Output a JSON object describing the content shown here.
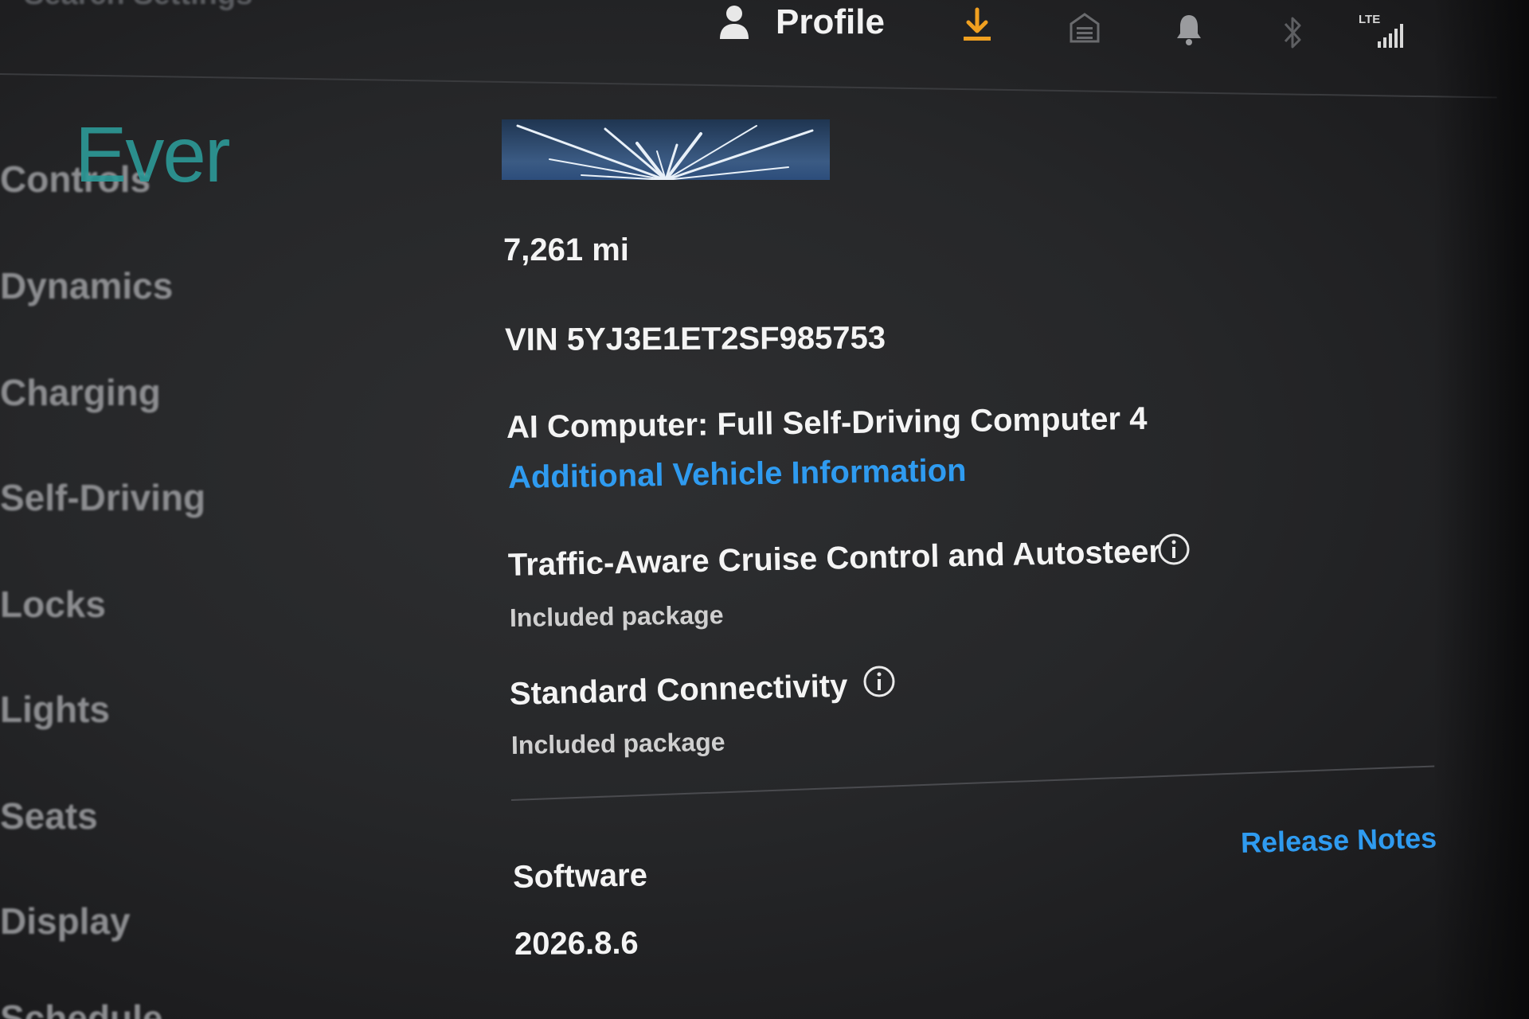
{
  "topbar": {
    "search_placeholder": "Search Settings",
    "profile_label": "Profile",
    "icons": [
      "person-icon",
      "download-icon",
      "garage-icon",
      "bell-icon",
      "bluetooth-icon",
      "lte-signal-icon"
    ],
    "lte_label": "LTE",
    "accent_color": "#f0a020"
  },
  "logo_overlay": {
    "text": "Ever",
    "color": "#2c9a98"
  },
  "sidebar": {
    "items": [
      {
        "label": "Controls"
      },
      {
        "label": "Dynamics"
      },
      {
        "label": "Charging"
      },
      {
        "label": "Self-Driving"
      },
      {
        "label": "Locks"
      },
      {
        "label": "Lights"
      },
      {
        "label": "Seats"
      },
      {
        "label": "Display"
      },
      {
        "label": "Schedule"
      }
    ]
  },
  "vehicle": {
    "mileage": "7,261 mi",
    "vin": "VIN 5YJ3E1ET2SF985753",
    "ai_computer": "AI Computer: Full Self-Driving Computer 4",
    "additional_info_link": "Additional Vehicle Information",
    "link_color": "#2f9bf0"
  },
  "features": [
    {
      "title": "Traffic-Aware Cruise Control and Autosteer",
      "status": "Included package",
      "icon": "info-icon"
    },
    {
      "title": "Standard Connectivity",
      "status": "Included package",
      "icon": "info-icon"
    }
  ],
  "software": {
    "label": "Software",
    "version": "2026.8.6",
    "release_notes_link": "Release Notes"
  }
}
